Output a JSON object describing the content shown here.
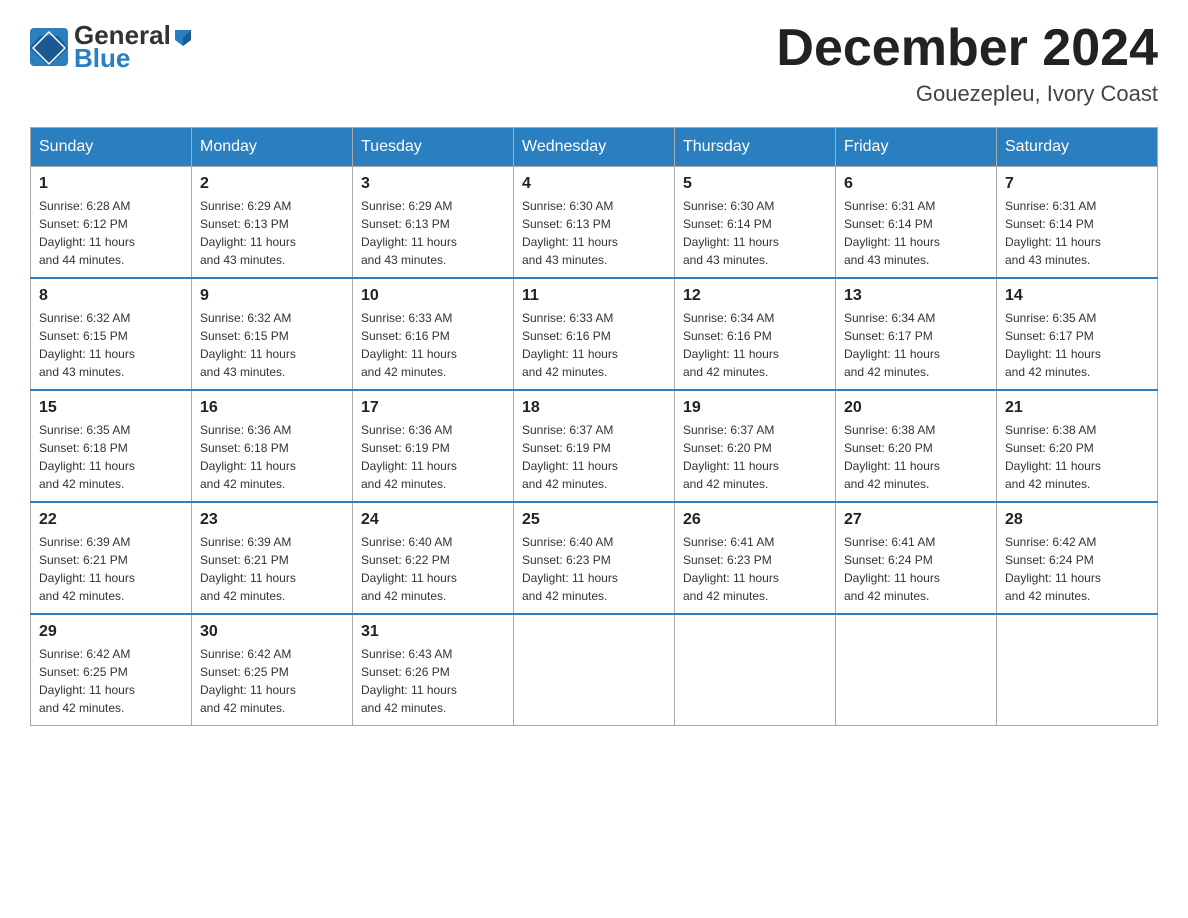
{
  "header": {
    "logo": {
      "general": "General",
      "blue": "Blue"
    },
    "title": "December 2024",
    "location": "Gouezepleu, Ivory Coast"
  },
  "days_of_week": [
    "Sunday",
    "Monday",
    "Tuesday",
    "Wednesday",
    "Thursday",
    "Friday",
    "Saturday"
  ],
  "weeks": [
    [
      {
        "day": "1",
        "sunrise": "6:28 AM",
        "sunset": "6:12 PM",
        "daylight": "11 hours and 44 minutes."
      },
      {
        "day": "2",
        "sunrise": "6:29 AM",
        "sunset": "6:13 PM",
        "daylight": "11 hours and 43 minutes."
      },
      {
        "day": "3",
        "sunrise": "6:29 AM",
        "sunset": "6:13 PM",
        "daylight": "11 hours and 43 minutes."
      },
      {
        "day": "4",
        "sunrise": "6:30 AM",
        "sunset": "6:13 PM",
        "daylight": "11 hours and 43 minutes."
      },
      {
        "day": "5",
        "sunrise": "6:30 AM",
        "sunset": "6:14 PM",
        "daylight": "11 hours and 43 minutes."
      },
      {
        "day": "6",
        "sunrise": "6:31 AM",
        "sunset": "6:14 PM",
        "daylight": "11 hours and 43 minutes."
      },
      {
        "day": "7",
        "sunrise": "6:31 AM",
        "sunset": "6:14 PM",
        "daylight": "11 hours and 43 minutes."
      }
    ],
    [
      {
        "day": "8",
        "sunrise": "6:32 AM",
        "sunset": "6:15 PM",
        "daylight": "11 hours and 43 minutes."
      },
      {
        "day": "9",
        "sunrise": "6:32 AM",
        "sunset": "6:15 PM",
        "daylight": "11 hours and 43 minutes."
      },
      {
        "day": "10",
        "sunrise": "6:33 AM",
        "sunset": "6:16 PM",
        "daylight": "11 hours and 42 minutes."
      },
      {
        "day": "11",
        "sunrise": "6:33 AM",
        "sunset": "6:16 PM",
        "daylight": "11 hours and 42 minutes."
      },
      {
        "day": "12",
        "sunrise": "6:34 AM",
        "sunset": "6:16 PM",
        "daylight": "11 hours and 42 minutes."
      },
      {
        "day": "13",
        "sunrise": "6:34 AM",
        "sunset": "6:17 PM",
        "daylight": "11 hours and 42 minutes."
      },
      {
        "day": "14",
        "sunrise": "6:35 AM",
        "sunset": "6:17 PM",
        "daylight": "11 hours and 42 minutes."
      }
    ],
    [
      {
        "day": "15",
        "sunrise": "6:35 AM",
        "sunset": "6:18 PM",
        "daylight": "11 hours and 42 minutes."
      },
      {
        "day": "16",
        "sunrise": "6:36 AM",
        "sunset": "6:18 PM",
        "daylight": "11 hours and 42 minutes."
      },
      {
        "day": "17",
        "sunrise": "6:36 AM",
        "sunset": "6:19 PM",
        "daylight": "11 hours and 42 minutes."
      },
      {
        "day": "18",
        "sunrise": "6:37 AM",
        "sunset": "6:19 PM",
        "daylight": "11 hours and 42 minutes."
      },
      {
        "day": "19",
        "sunrise": "6:37 AM",
        "sunset": "6:20 PM",
        "daylight": "11 hours and 42 minutes."
      },
      {
        "day": "20",
        "sunrise": "6:38 AM",
        "sunset": "6:20 PM",
        "daylight": "11 hours and 42 minutes."
      },
      {
        "day": "21",
        "sunrise": "6:38 AM",
        "sunset": "6:20 PM",
        "daylight": "11 hours and 42 minutes."
      }
    ],
    [
      {
        "day": "22",
        "sunrise": "6:39 AM",
        "sunset": "6:21 PM",
        "daylight": "11 hours and 42 minutes."
      },
      {
        "day": "23",
        "sunrise": "6:39 AM",
        "sunset": "6:21 PM",
        "daylight": "11 hours and 42 minutes."
      },
      {
        "day": "24",
        "sunrise": "6:40 AM",
        "sunset": "6:22 PM",
        "daylight": "11 hours and 42 minutes."
      },
      {
        "day": "25",
        "sunrise": "6:40 AM",
        "sunset": "6:23 PM",
        "daylight": "11 hours and 42 minutes."
      },
      {
        "day": "26",
        "sunrise": "6:41 AM",
        "sunset": "6:23 PM",
        "daylight": "11 hours and 42 minutes."
      },
      {
        "day": "27",
        "sunrise": "6:41 AM",
        "sunset": "6:24 PM",
        "daylight": "11 hours and 42 minutes."
      },
      {
        "day": "28",
        "sunrise": "6:42 AM",
        "sunset": "6:24 PM",
        "daylight": "11 hours and 42 minutes."
      }
    ],
    [
      {
        "day": "29",
        "sunrise": "6:42 AM",
        "sunset": "6:25 PM",
        "daylight": "11 hours and 42 minutes."
      },
      {
        "day": "30",
        "sunrise": "6:42 AM",
        "sunset": "6:25 PM",
        "daylight": "11 hours and 42 minutes."
      },
      {
        "day": "31",
        "sunrise": "6:43 AM",
        "sunset": "6:26 PM",
        "daylight": "11 hours and 42 minutes."
      },
      null,
      null,
      null,
      null
    ]
  ],
  "labels": {
    "sunrise": "Sunrise:",
    "sunset": "Sunset:",
    "daylight": "Daylight:"
  },
  "colors": {
    "header_bg": "#2a7fc1",
    "header_text": "#ffffff",
    "border": "#aaaaaa",
    "title": "#222222",
    "accent_blue": "#1a6fa8"
  }
}
